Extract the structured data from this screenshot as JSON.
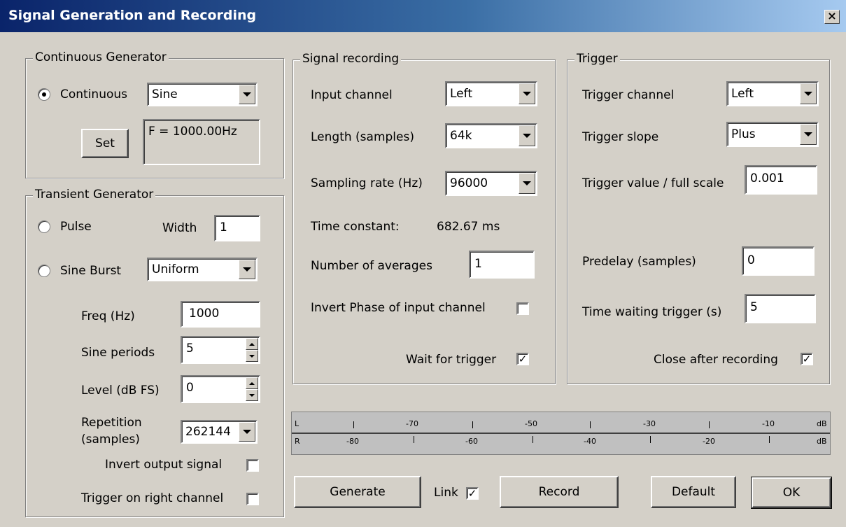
{
  "window": {
    "title": "Signal Generation and Recording",
    "close_glyph": "×"
  },
  "continuous": {
    "title": "Continuous Generator",
    "radio_label": "Continuous",
    "waveform": "Sine",
    "set_label": "Set",
    "frequency_display": "F = 1000.00Hz"
  },
  "transient": {
    "title": "Transient Generator",
    "pulse_label": "Pulse",
    "width_label": "Width",
    "width_value": "1",
    "sine_burst_label": "Sine Burst",
    "burst_window": "Uniform",
    "freq_label": "Freq (Hz)",
    "freq_value": "1000",
    "periods_label": "Sine periods",
    "periods_value": "5",
    "level_label": "Level (dB FS)",
    "level_value": "0",
    "repetition_label_1": "Repetition",
    "repetition_label_2": "(samples)",
    "repetition_value": "262144",
    "invert_label": "Invert output signal",
    "trigger_right_label": "Trigger on right channel"
  },
  "recording": {
    "title": "Signal recording",
    "input_channel_label": "Input channel",
    "input_channel_value": "Left",
    "length_label": "Length (samples)",
    "length_value": "64k",
    "rate_label": "Sampling rate (Hz)",
    "rate_value": "96000",
    "time_constant_label": "Time constant:",
    "time_constant_value": "682.67 ms",
    "averages_label": "Number of averages",
    "averages_value": "1",
    "invert_phase_label": "Invert Phase of input channel",
    "wait_trigger_label": "Wait for trigger",
    "check_glyph": "✓"
  },
  "trigger": {
    "title": "Trigger",
    "channel_label": "Trigger channel",
    "channel_value": "Left",
    "slope_label": "Trigger slope",
    "slope_value": "Plus",
    "value_label": "Trigger value / full scale",
    "value_value": "0.001",
    "predelay_label": "Predelay (samples)",
    "predelay_value": "0",
    "waiting_label": "Time waiting trigger (s)",
    "waiting_value": "5",
    "close_after_label": "Close after recording"
  },
  "meter": {
    "l_label": "L",
    "r_label": "R",
    "top_scale": [
      "-70",
      "-50",
      "-30",
      "-10",
      "dB"
    ],
    "bottom_scale": [
      "-80",
      "-60",
      "-40",
      "-20",
      "dB"
    ]
  },
  "buttons": {
    "generate": "Generate",
    "link": "Link",
    "record": "Record",
    "default": "Default",
    "ok": "OK"
  }
}
